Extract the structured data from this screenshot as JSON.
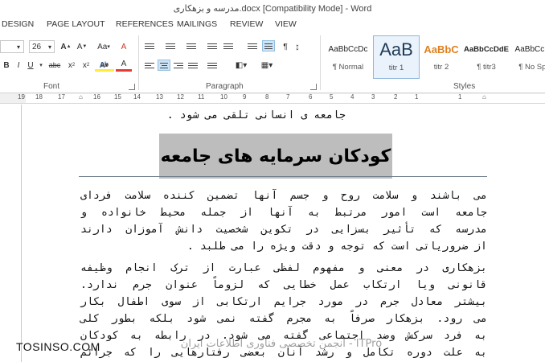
{
  "window": {
    "title": "مدرسه و بزهکاری.docx [Compatibility Mode] - Word"
  },
  "tabs": [
    {
      "label": "DESIGN"
    },
    {
      "label": "PAGE LAYOUT"
    },
    {
      "label": "REFERENCES"
    },
    {
      "label": "MAILINGS"
    },
    {
      "label": "REVIEW"
    },
    {
      "label": "VIEW"
    }
  ],
  "font_group": {
    "label": "Font",
    "size": "26",
    "grow_icon": "A",
    "shrink_icon": "A",
    "case_icon": "Aa",
    "clear_icon": "A",
    "bold": "B",
    "italic": "I",
    "underline": "U",
    "strike": "abc",
    "subscript": "x",
    "superscript": "x",
    "effects": "A",
    "highlight": "ab",
    "fontcolor": "A"
  },
  "paragraph_group": {
    "label": "Paragraph",
    "pilcrow": "¶"
  },
  "styles_group": {
    "label": "Styles",
    "items": [
      {
        "preview": "AaBbCcDc",
        "name": "¶ Normal"
      },
      {
        "preview": "AaB",
        "name": "titr 1"
      },
      {
        "preview": "AaBbC",
        "name": "titr 2"
      },
      {
        "preview": "AaBbCcDdE",
        "name": "¶ titr3"
      },
      {
        "preview": "AaBbCcDc",
        "name": "¶ No Spa"
      }
    ]
  },
  "ruler": {
    "numbers": [
      "19",
      "18",
      "17",
      "16",
      "15",
      "14",
      "13",
      "12",
      "11",
      "10",
      "9",
      "8",
      "7",
      "6",
      "5",
      "4",
      "3",
      "2",
      "1",
      "1"
    ]
  },
  "document": {
    "line0": "جامعه ی انسانی تلقی می شود .",
    "heading": "کودکان سرمایه های جامعه",
    "para1": [
      "می باشند و سلامت روح و جسم آنها تضمین کننده سلامت فردای",
      "جامعه است امور مرتبط به آنها از جمله محیط خانواده و",
      "مدرسه که تأثیر بسزایی در تکوین شخصیت دانش آموزان دارند",
      "از ضروریاتی است که توجه و دقت ویژه را می طلبد ."
    ],
    "para2": [
      "بزهکاری در معنی و مفهوم لفظی عبارت از ترک انجام وظیفه",
      "قانونی ویا ارتکاب عمل خطایی که لزوماً عنوان جرم ندارد.",
      "بیشتر معادل جرم در مورد جرایم ارتکابی از سوی اطفال بکار",
      "می رود. بزهکار صرفاً به مجرم گفته نمی شود بلکه بطور کلی",
      "به فرد سرکش وضد اجتماعی گفته می شود. در رابطه به کودکان",
      "به علت دوره تکامل و رشد آنان بعضی رفتارهایی را که جرائم"
    ]
  },
  "watermarks": {
    "site": "TOSINSO.COM",
    "center": "ITPro - انجمن تخصصی فناوری اطلاعات ایران"
  }
}
